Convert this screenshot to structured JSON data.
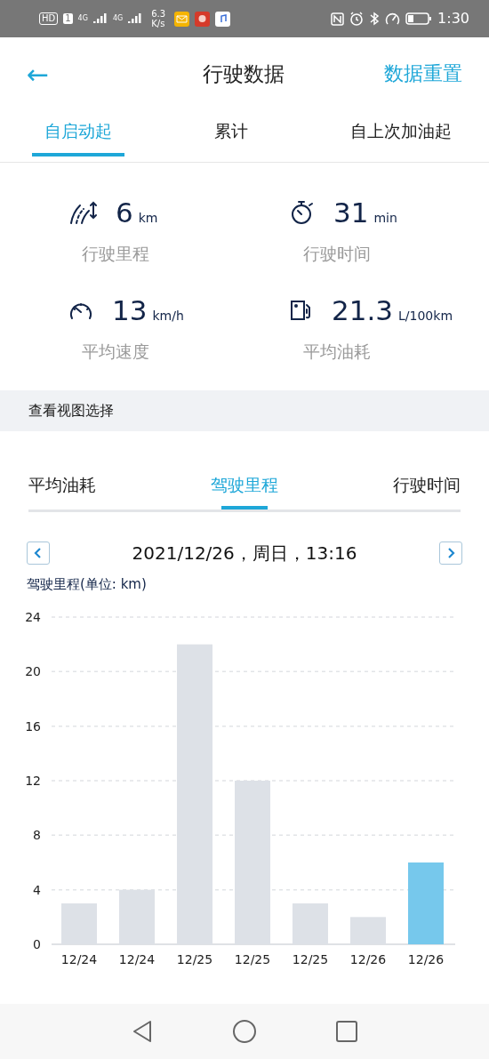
{
  "status_bar": {
    "left_texts": [
      "HD",
      "1",
      "4G",
      "4G"
    ],
    "speed": [
      "6.3",
      "K/s"
    ],
    "time": "1:30"
  },
  "header": {
    "back": "←",
    "title": "行驶数据",
    "action": "数据重置"
  },
  "tabs": [
    {
      "label": "自启动起",
      "selected": true
    },
    {
      "label": "累计",
      "selected": false
    },
    {
      "label": "自上次加油起",
      "selected": false
    }
  ],
  "stats": [
    {
      "kind": "distance",
      "value": "6",
      "unit": "km",
      "label": "行驶里程"
    },
    {
      "kind": "time",
      "value": "31",
      "unit": "min",
      "label": "行驶时间"
    },
    {
      "kind": "speed",
      "value": "13",
      "unit": "km/h",
      "label": "平均速度"
    },
    {
      "kind": "fuel",
      "value": "21.3",
      "unit": "L/100km",
      "label": "平均油耗"
    }
  ],
  "section_title": "查看视图选择",
  "chart_tabs": [
    {
      "label": "平均油耗",
      "selected": false
    },
    {
      "label": "驾驶里程",
      "selected": true
    },
    {
      "label": "行驶时间",
      "selected": false
    }
  ],
  "date_nav": {
    "date": "2021/12/26，周日，13:16"
  },
  "chart": {
    "label": "驾驶里程(单位: km)",
    "chart_data": {
      "type": "bar",
      "categories": [
        "12/24",
        "12/24",
        "12/25",
        "12/25",
        "12/25",
        "12/26",
        "12/26"
      ],
      "series": [
        {
          "color": "#dde1e7",
          "values": [
            3,
            4,
            22,
            12,
            3,
            2,
            null
          ]
        },
        {
          "color": "#76c8ec",
          "values": [
            null,
            null,
            null,
            null,
            null,
            null,
            6
          ]
        }
      ],
      "grid": true,
      "ylim": [
        0,
        24
      ],
      "yticks": [
        0,
        4,
        8,
        12,
        16,
        20,
        24
      ]
    }
  }
}
